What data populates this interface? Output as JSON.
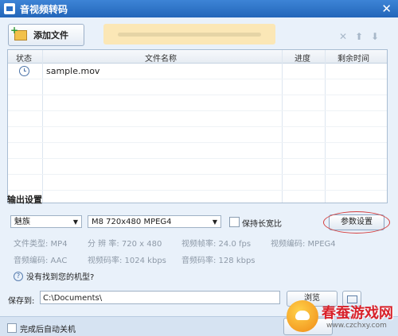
{
  "window": {
    "title": "音视频转码",
    "close_glyph": "✕"
  },
  "toolbar": {
    "add_file_label": "添加文件",
    "remove_icon": "x-icon",
    "up_icon": "arrow-up-icon",
    "down_icon": "arrow-down-icon"
  },
  "table": {
    "columns": [
      "状态",
      "文件名称",
      "进度",
      "剩余时间"
    ],
    "rows": [
      {
        "status": "clock-icon",
        "name": "sample.mov",
        "progress": "",
        "remaining": ""
      }
    ]
  },
  "output": {
    "section_label": "输出设置",
    "device_select": "魅族",
    "format_select": "M8 720x480 MPEG4",
    "keep_ratio_label": "保持长宽比",
    "keep_ratio_checked": false,
    "params_button": "参数设置",
    "info": {
      "file_type": "文件类型: MP4",
      "resolution": "分 辨 率: 720 x 480",
      "frame_rate": "视频帧率: 24.0 fps",
      "video_codec": "视频编码: MPEG4",
      "audio_codec": "音频编码: AAC",
      "video_bitrate": "视频码率: 1024 kbps",
      "audio_bitrate": "音频码率: 128 kbps"
    },
    "help_link": "没有找到您的机型?"
  },
  "save": {
    "label": "保存到:",
    "path": "C:\\Documents\\",
    "browse_label": "浏览"
  },
  "footer": {
    "shutdown_label": "完成后自动关机",
    "shutdown_checked": false
  },
  "watermark": {
    "title": "春蚕游戏网",
    "url": "www.czchxy.com"
  },
  "colors": {
    "titlebar": "#2a6fc5",
    "accent_red": "#d54040",
    "watermark_red": "#d8222b"
  }
}
